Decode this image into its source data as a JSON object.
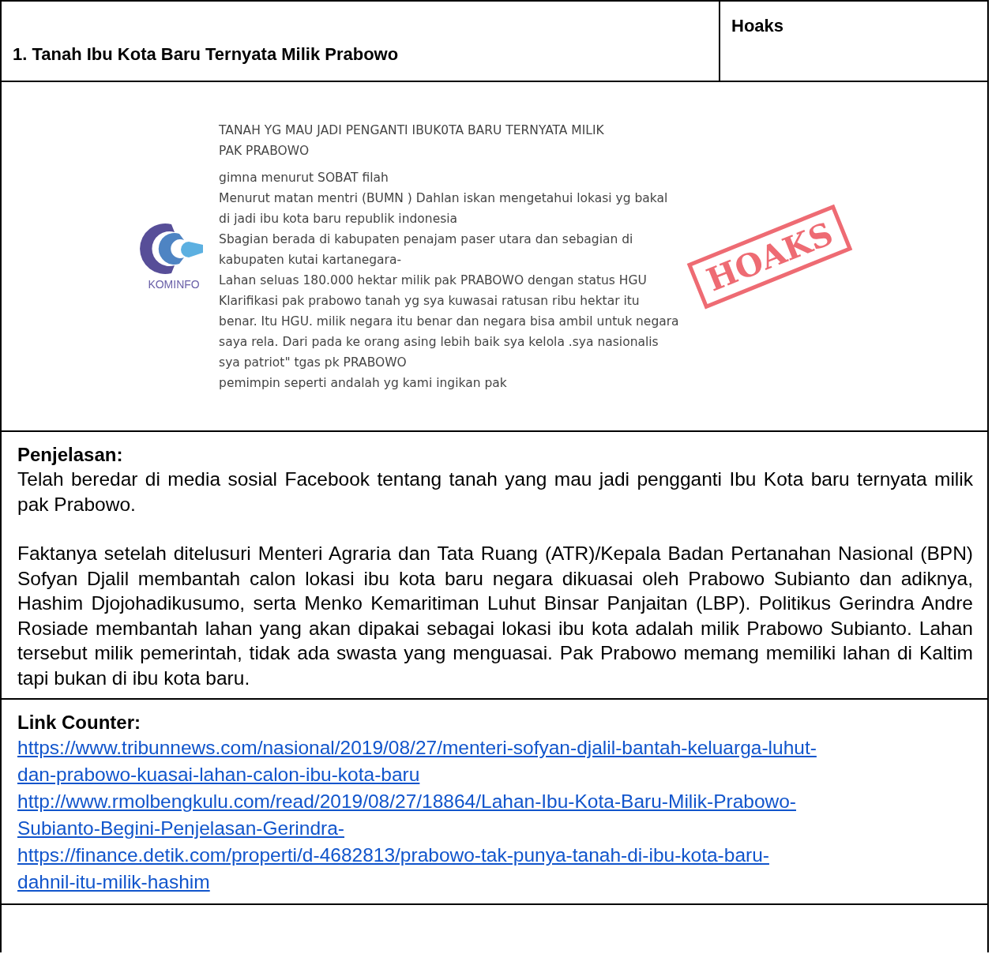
{
  "header": {
    "title": "1. Tanah Ibu Kota Baru Ternyata Milik Prabowo",
    "verdict": "Hoaks"
  },
  "evidence": {
    "post_lines": [
      "TANAH YG MAU JADI PENGANTI IBUK0TA BARU TERNYATA MILIK",
      "PAK PRABOWO",
      "gimna menurut SOBAT filah",
      "Menurut matan mentri (BUMN ) Dahlan iskan mengetahui lokasi yg bakal",
      "di jadi ibu kota baru republik indonesia",
      "Sbagian berada di kabupaten penajam paser utara dan sebagian di",
      "kabupaten kutai kartanegara-",
      "Lahan seluas 180.000 hektar milik pak PRABOWO dengan status HGU",
      "Klarifikasi pak prabowo tanah yg sya kuwasai ratusan ribu hektar itu",
      "benar. Itu HGU. milik negara itu benar dan negara bisa ambil untuk negara",
      "saya rela. Dari pada ke orang asing lebih baik sya kelola .sya nasionalis",
      "sya patriot\" tgas pk PRABOWO",
      "pemimpin seperti andalah yg kami ingikan pak"
    ],
    "stamp": "HOAKS",
    "logo_text": "KOMINFO"
  },
  "explanation": {
    "heading": "Penjelasan:",
    "paragraphs": [
      "Telah beredar di media sosial Facebook tentang tanah yang mau jadi pengganti Ibu Kota baru ternyata milik pak Prabowo.",
      "Faktanya setelah ditelusuri Menteri Agraria dan Tata Ruang (ATR)/Kepala Badan Pertanahan Nasional (BPN) Sofyan Djalil membantah calon lokasi ibu kota baru negara dikuasai oleh Prabowo Subianto dan adiknya, Hashim Djojohadikusumo, serta Menko Kemaritiman Luhut Binsar Panjaitan (LBP). Politikus Gerindra Andre Rosiade membantah lahan yang akan dipakai sebagai lokasi ibu kota adalah milik Prabowo Subianto. Lahan tersebut milik pemerintah, tidak ada swasta yang menguasai. Pak Prabowo memang memiliki lahan di Kaltim tapi bukan di ibu kota baru."
    ]
  },
  "links": {
    "heading": "Link Counter:",
    "urls": [
      [
        "https://www.tribunnews.com/nasional/2019/08/27/menteri-sofyan-djalil-bantah-keluarga-luhut-",
        "dan-prabowo-kuasai-lahan-calon-ibu-kota-baru"
      ],
      [
        "http://www.rmolbengkulu.com/read/2019/08/27/18864/Lahan-Ibu-Kota-Baru-Milik-Prabowo-",
        "Subianto-Begini-Penjelasan-Gerindra-"
      ],
      [
        "https://finance.detik.com/properti/d-4682813/prabowo-tak-punya-tanah-di-ibu-kota-baru-",
        "dahnil-itu-milik-hashim"
      ]
    ]
  }
}
